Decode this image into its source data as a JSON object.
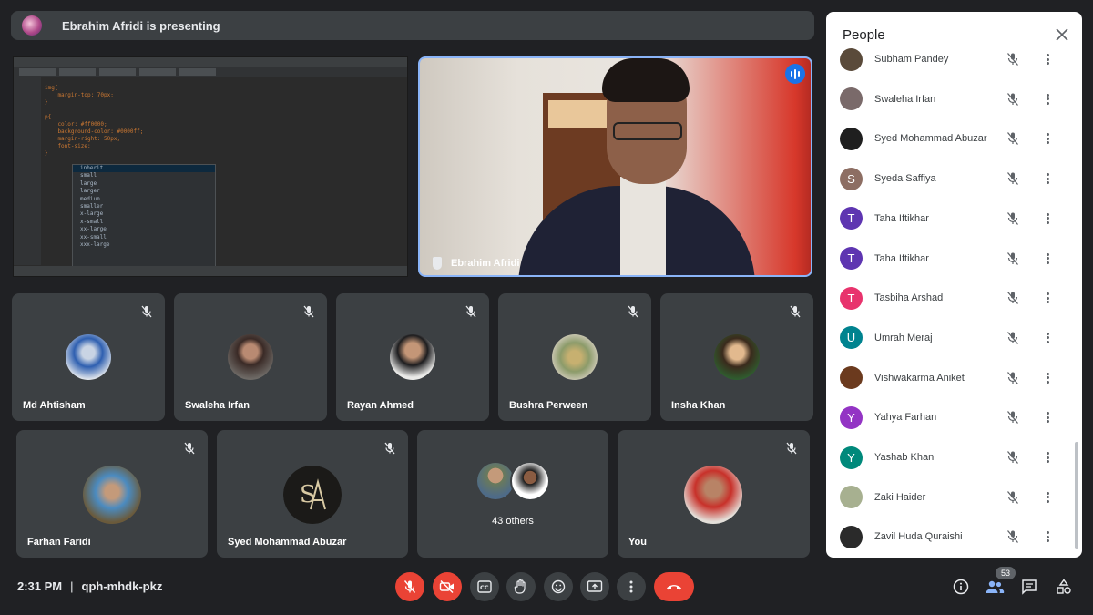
{
  "banner": {
    "text": "Ebrahim Afridi is presenting",
    "icon": "presenter-avatar-icon"
  },
  "screen_share": {
    "code_lines": [
      [
        "",
        "img{"
      ],
      [
        "",
        "    margin-top: 70px;"
      ],
      [
        "",
        "}"
      ],
      [
        "",
        ""
      ],
      [
        "",
        "p{"
      ],
      [
        "",
        "    color: #ff0000;"
      ],
      [
        "",
        "    background-color: #0000ff;"
      ],
      [
        "",
        "    margin-right: 50px;"
      ],
      [
        "",
        "    font-size: "
      ],
      [
        "",
        "}"
      ]
    ],
    "autocomplete": [
      "inherit",
      "small",
      "large",
      "larger",
      "medium",
      "smaller",
      "x-large",
      "x-small",
      "xx-large",
      "xx-small",
      "xxx-large"
    ]
  },
  "main_video": {
    "name": "Ebrahim Afridi"
  },
  "tiles": [
    {
      "name": "Md Ahtisham"
    },
    {
      "name": "Swaleha Irfan"
    },
    {
      "name": "Rayan Ahmed"
    },
    {
      "name": "Bushra Perween"
    },
    {
      "name": "Insha Khan"
    },
    {
      "name": "Farhan Faridi"
    },
    {
      "name": "Syed Mohammad Abuzar"
    },
    {
      "name": "You"
    }
  ],
  "others_tile": {
    "label": "43 others"
  },
  "people_panel": {
    "title": "People",
    "participants": [
      {
        "name": "Subham Pandey",
        "initial": "",
        "color": "#5a4a3a"
      },
      {
        "name": "Swaleha Irfan",
        "initial": "",
        "color": "#7a6a6a"
      },
      {
        "name": "Syed Mohammad Abuzar",
        "initial": "",
        "color": "#1f1f1f"
      },
      {
        "name": "Syeda Saffiya",
        "initial": "S",
        "color": "#8d6e63"
      },
      {
        "name": "Taha Iftikhar",
        "initial": "T",
        "color": "#5e35b1"
      },
      {
        "name": "Taha Iftikhar",
        "initial": "T",
        "color": "#5e35b1"
      },
      {
        "name": "Tasbiha Arshad",
        "initial": "T",
        "color": "#e8336d"
      },
      {
        "name": "Umrah Meraj",
        "initial": "U",
        "color": "#00838f"
      },
      {
        "name": "Vishwakarma Aniket",
        "initial": "",
        "color": "#6b3a1e"
      },
      {
        "name": "Yahya Farhan",
        "initial": "Y",
        "color": "#9334c4"
      },
      {
        "name": "Yashab Khan",
        "initial": "Y",
        "color": "#00897b"
      },
      {
        "name": "Zaki Haider",
        "initial": "",
        "color": "#a7b090"
      },
      {
        "name": "Zavil Huda Quraishi",
        "initial": "",
        "color": "#2a2a2a"
      }
    ]
  },
  "bottom_bar": {
    "time": "2:31 PM",
    "separator": "|",
    "meeting_code": "qph-mhdk-pkz",
    "people_count": "53"
  },
  "colors": {
    "accent": "#8ab4f8",
    "danger": "#ea4335",
    "tile_bg": "#3c4043",
    "page_bg": "#202124"
  }
}
